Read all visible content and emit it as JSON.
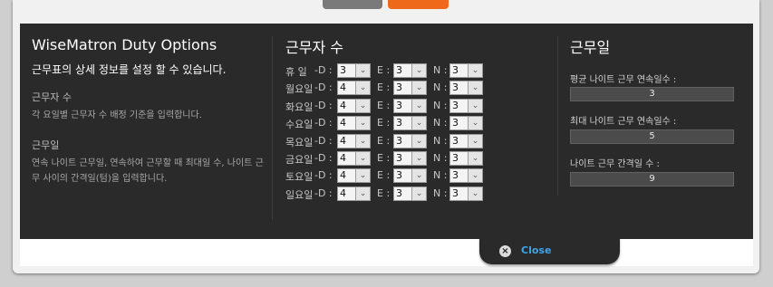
{
  "column1": {
    "title": "WiseMatron Duty Options",
    "subtitle": "근무표의 상세 정보를 설정 할 수 있습니다.",
    "section1_heading": "근무자 수",
    "section1_desc": "각 요일별 근무자 수 배정 기준을 입력합니다.",
    "section2_heading": "근무일",
    "section2_desc": "연속 나이트 근무일, 연속하여 근무할 때 최대일 수, 나이트 근무 사이의 간격일(텀)을 입력합니다."
  },
  "column2": {
    "title": "근무자 수",
    "d_label": "-D :",
    "e_label": "E :",
    "n_label": "N :",
    "rows": [
      {
        "day": "휴  일",
        "d": "3",
        "e": "3",
        "n": "3"
      },
      {
        "day": "월요일",
        "d": "4",
        "e": "3",
        "n": "3"
      },
      {
        "day": "화요일",
        "d": "4",
        "e": "3",
        "n": "3"
      },
      {
        "day": "수요일",
        "d": "4",
        "e": "3",
        "n": "3"
      },
      {
        "day": "목요일",
        "d": "4",
        "e": "3",
        "n": "3"
      },
      {
        "day": "금요일",
        "d": "4",
        "e": "3",
        "n": "3"
      },
      {
        "day": "토요일",
        "d": "4",
        "e": "3",
        "n": "3"
      },
      {
        "day": "일요일",
        "d": "4",
        "e": "3",
        "n": "3"
      }
    ]
  },
  "column3": {
    "title": "근무일",
    "avg_night_label": "평균 나이트 근무 연속일수 :",
    "avg_night_value": "3",
    "max_night_label": "최대 나이트 근무 연속일수 :",
    "max_night_value": "5",
    "night_interval_label": "나이트 근무 간격일 수 :",
    "night_interval_value": "9"
  },
  "footer": {
    "close_label": "Close",
    "close_icon": "close-x-icon"
  },
  "colors": {
    "panel_bg": "#2a2a2a",
    "close_text": "#3ea5ea",
    "top_button_orange": "#ee6a1a",
    "top_button_gray": "#7a7a7a"
  }
}
